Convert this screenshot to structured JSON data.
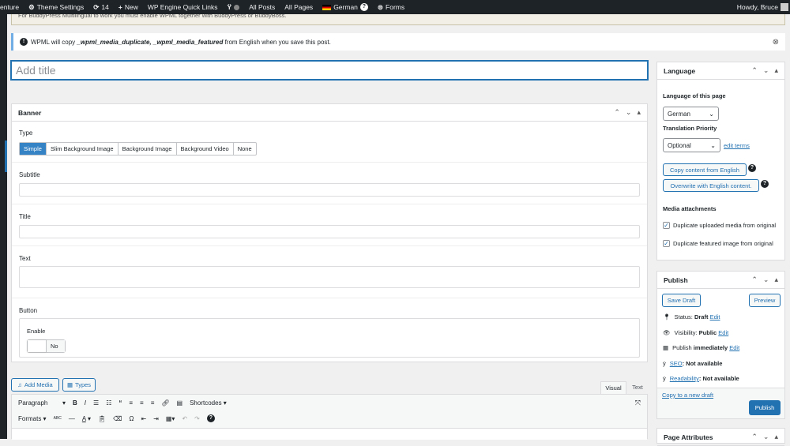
{
  "adminbar": {
    "items": [
      "enture",
      "Theme Settings",
      "14",
      "New",
      "WP Engine Quick Links",
      "All Posts",
      "All Pages",
      "German",
      "Forms"
    ],
    "howdy": "Howdy, Bruce"
  },
  "notices": {
    "old": "For BuddyPress Multilingual to work you must enable WPML together with BuddyPress or BuddyBoss.",
    "wpml_pre": "WPML will copy ",
    "wpml_fields": "_wpml_media_duplicate, _wpml_media_featured",
    "wpml_post": " from English when you save this post."
  },
  "title": {
    "placeholder": "Add title"
  },
  "banner": {
    "heading": "Banner",
    "type_label": "Type",
    "types": [
      "Simple",
      "Slim Background Image",
      "Background Image",
      "Background Video",
      "None"
    ],
    "subtitle_label": "Subtitle",
    "title_label": "Title",
    "text_label": "Text",
    "button_label": "Button",
    "enable_label": "Enable",
    "toggle_value": "No"
  },
  "editor": {
    "add_media": "Add Media",
    "types": "Types",
    "tab_visual": "Visual",
    "tab_text": "Text",
    "paragraph": "Paragraph",
    "shortcodes": "Shortcodes ▾",
    "formats": "Formats ▾"
  },
  "language": {
    "heading": "Language",
    "lang_label": "Language of this page",
    "lang_value": "German",
    "priority_label": "Translation Priority",
    "priority_value": "Optional",
    "edit_terms": "edit terms",
    "copy_btn": "Copy content from English",
    "overwrite_btn": "Overwrite with English content.",
    "media_label": "Media attachments",
    "dup_media": "Duplicate uploaded media from original",
    "dup_featured": "Duplicate featured image from original"
  },
  "publish": {
    "heading": "Publish",
    "save_draft": "Save Draft",
    "preview": "Preview",
    "status_label": "Status: ",
    "status_value": "Draft",
    "visibility_label": "Visibility: ",
    "visibility_value": "Public",
    "publish_pre": "Publish ",
    "publish_value": "immediately",
    "edit": "Edit",
    "seo_link": "SEO",
    "seo_value": ": Not available",
    "read_link": "Readability",
    "read_value": ": Not available",
    "copy_draft": "Copy to a new draft",
    "publish_btn": "Publish"
  },
  "page_attributes": {
    "heading": "Page Attributes"
  }
}
